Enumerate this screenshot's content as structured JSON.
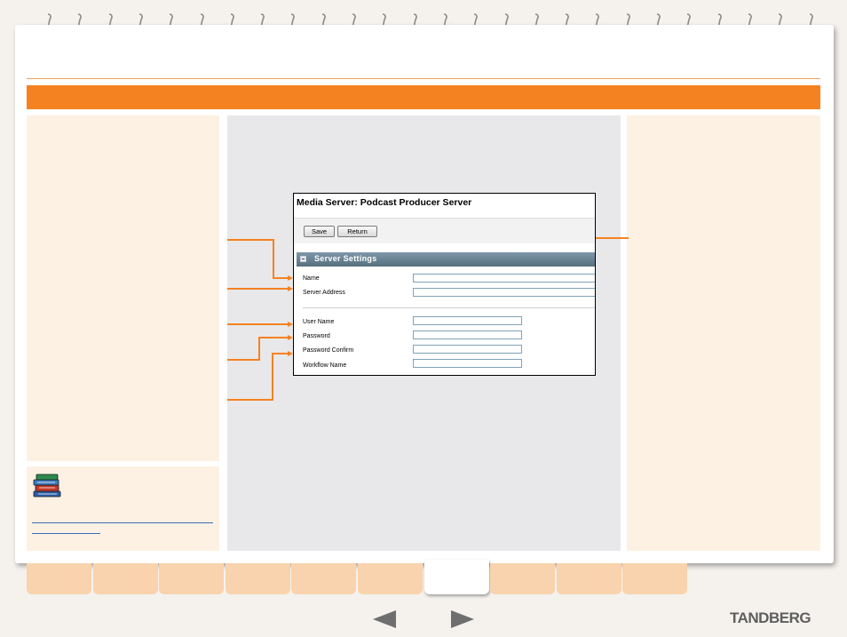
{
  "document": {
    "screenshot": {
      "title": "Media Server: Podcast Producer Server",
      "buttons": {
        "save": "Save",
        "return": "Return"
      },
      "section": {
        "title": "Server Settings"
      },
      "fields": [
        {
          "label": "Name",
          "value": ""
        },
        {
          "label": "Server Address",
          "value": ""
        },
        {
          "label": "User Name",
          "value": ""
        },
        {
          "label": "Password",
          "value": ""
        },
        {
          "label": "Password Confirm",
          "value": ""
        },
        {
          "label": "Workflow Name",
          "value": ""
        }
      ]
    },
    "brand": "TANDBERG",
    "accent_color": "#f58220",
    "tab_count": 10,
    "active_tab_index": 6,
    "icons": [
      "notebook-ring-icon",
      "books-icon",
      "previous-page-arrow-icon",
      "next-page-arrow-icon"
    ]
  }
}
